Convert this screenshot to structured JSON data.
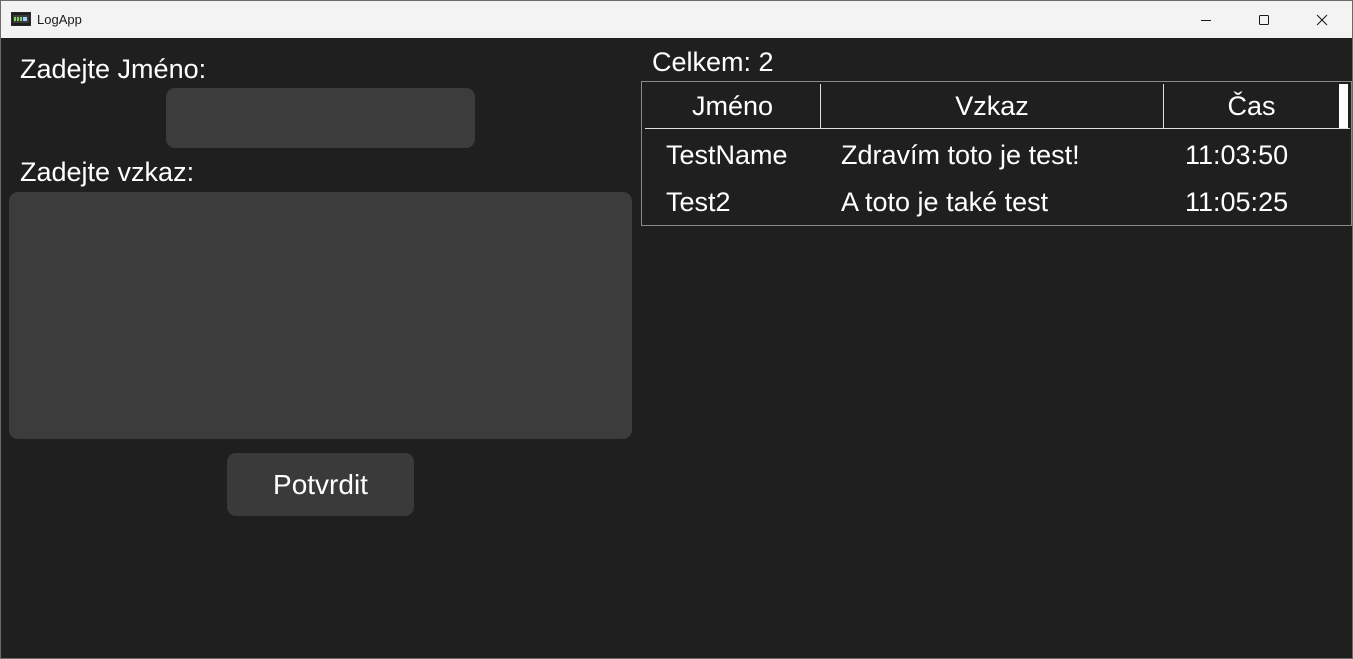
{
  "window": {
    "title": "LogApp",
    "icon": "terminal-app-icon",
    "controls": [
      "minimize-icon",
      "maximize-icon",
      "close-icon"
    ]
  },
  "form": {
    "name_label": "Zadejte Jméno:",
    "name_value": "",
    "message_label": "Zadejte vzkaz:",
    "message_value": "",
    "submit_label": "Potvrdit"
  },
  "log": {
    "count_label": "Celkem:",
    "count_value": "2",
    "columns": [
      "Jméno",
      "Vzkaz",
      "Čas"
    ],
    "rows": [
      {
        "name": "TestName",
        "message": "Zdravím toto je test!",
        "time": "11:03:50"
      },
      {
        "name": "Test2",
        "message": "A toto je také test",
        "time": "11:05:25"
      }
    ]
  },
  "colors": {
    "window_bg": "#1f1f1f",
    "titlebar_bg": "#f3f3f3",
    "input_bg": "#3c3c3c",
    "button_bg": "#3a3a3a",
    "text": "#ffffff"
  }
}
